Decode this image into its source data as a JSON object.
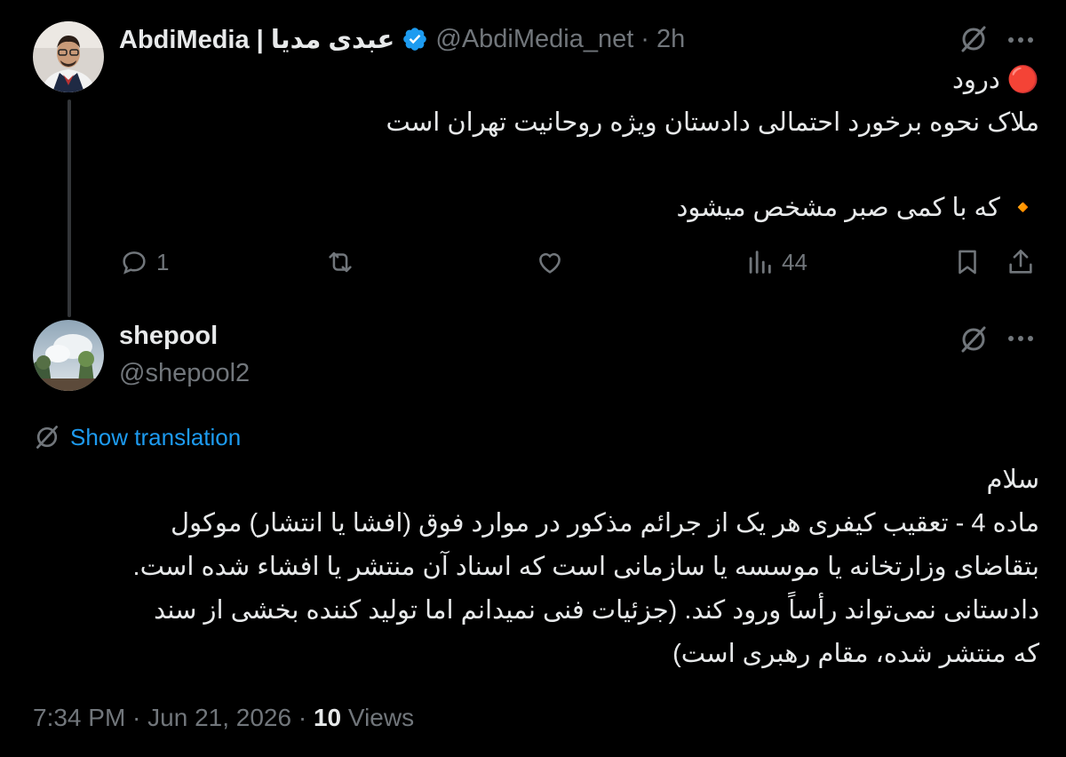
{
  "colors": {
    "background": "#000000",
    "text": "#e7e9ea",
    "muted": "#71767b",
    "accent": "#1d9bf0",
    "verified": "#1d9bf0"
  },
  "parent_tweet": {
    "display_name": "AbdiMedia | عبدی مدیا",
    "verified": true,
    "handle": "@AbdiMedia_net",
    "time": "2h",
    "lines": [
      "🔴 درود",
      "ملاک نحوه برخورد احتمالی دادستان ویژه روحانیت تهران است",
      "",
      "🔸 که با کمی صبر مشخص میشود"
    ],
    "actions": {
      "replies": "1",
      "retweets": "",
      "likes": "",
      "views": "44"
    },
    "icons": [
      "grok-slash-icon",
      "more-icon",
      "reply-icon",
      "retweet-icon",
      "like-icon",
      "views-icon",
      "bookmark-icon",
      "share-icon"
    ]
  },
  "reply_tweet": {
    "display_name": "shepool",
    "handle": "@shepool2",
    "show_translation": "Show translation",
    "lines": [
      "سلام",
      "ماده 4 - تعقیب کیفری هر یک از جرائم مذکور در موارد فوق (افشا یا انتشار) موکول",
      "بتقاضای وزارتخانه یا موسسه یا سازمانی است که اسناد آن منتشر یا  افشاء شده است.",
      "دادستانی نمی‌تواند رأساً ورود کند. (جزئیات فنی نمیدانم اما تولید کننده بخشی از سند",
      "که منتشر شده، مقام رهبری است)"
    ],
    "timestamp": "7:34 PM · Jun 21, 2026 · ",
    "views_count": "10",
    "views_label": " Views"
  }
}
